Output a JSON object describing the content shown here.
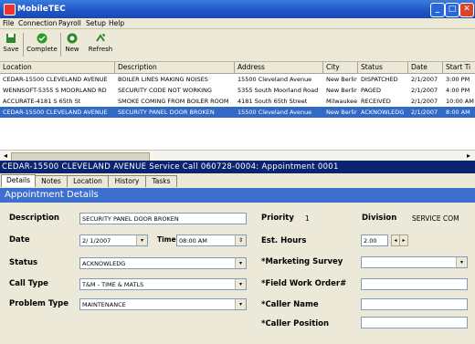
{
  "window": {
    "title": "MobileTEC"
  },
  "menu": [
    "File",
    "Connection",
    "Payroll",
    "Setup",
    "Help"
  ],
  "toolbar": {
    "save": "Save",
    "complete": "Complete",
    "new": "New",
    "refresh": "Refresh"
  },
  "grid": {
    "columns": [
      "Location",
      "Description",
      "Address",
      "City",
      "Status",
      "Date",
      "Start Ti"
    ],
    "rows": [
      [
        "CEDAR-15500 CLEVELAND AVENUE",
        "BOILER LINES MAKING NOISES",
        "15500 Cleveland Avenue",
        "New Berlin",
        "DISPATCHED",
        "2/1/2007",
        "3:00 PM"
      ],
      [
        "WENNSOFT-5355 S MOORLAND RD",
        "SECURITY CODE NOT WORKING",
        "5355 South Moorland Road",
        "New Berlin",
        "PAGED",
        "2/1/2007",
        "4:00 PM"
      ],
      [
        "ACCURATE-4181 S 65th St",
        "SMOKE COMING FROM BOILER ROOM",
        "4181 South 65th Street",
        "Milwaukee",
        "RECEIVED",
        "2/1/2007",
        "10:00 AM"
      ],
      [
        "CEDAR-15500 CLEVELAND AVENUE",
        "SECURITY PANEL DOOR BROKEN",
        "15500 Cleveland Avenue",
        "New Berlin",
        "ACKNOWLEDG",
        "2/1/2007",
        "8:00 AM"
      ]
    ],
    "selected_row": 3
  },
  "call_header": "CEDAR-15500 CLEVELAND AVENUE Service Call 060728-0004: Appointment 0001",
  "tabs": [
    "Details",
    "Notes",
    "Location",
    "History",
    "Tasks"
  ],
  "section_title": "Appointment Details",
  "form": {
    "description_label": "Description",
    "description": "SECURITY PANEL DOOR BROKEN",
    "date_label": "Date",
    "date": "2/ 1/2007",
    "time_label": "Time",
    "time": "08:00 AM",
    "status_label": "Status",
    "status": "ACKNOWLEDG",
    "call_type_label": "Call Type",
    "call_type": "T&M - TIME & MATLS",
    "problem_type_label": "Problem Type",
    "problem_type": "MAINTENANCE",
    "priority_label": "Priority",
    "priority": "1",
    "division_label": "Division",
    "division": "SERVICE COM",
    "est_hours_label": "Est. Hours",
    "est_hours": "2.00",
    "marketing_survey_label": "*Marketing Survey",
    "marketing_survey": "",
    "field_work_order_label": "*Field Work Order#",
    "field_work_order": "",
    "caller_name_label": "*Caller Name",
    "caller_name": "",
    "caller_position_label": "*Caller Position",
    "caller_position": ""
  },
  "colors": {
    "selection": "#3169c6",
    "header_dark": "#0a2470",
    "section": "#3d6fcc"
  }
}
